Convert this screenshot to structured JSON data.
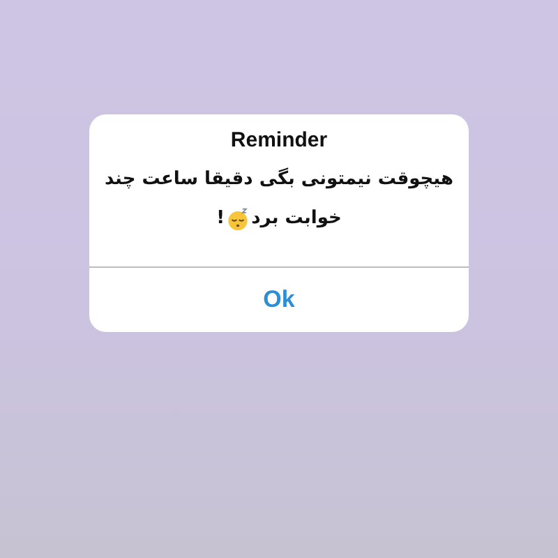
{
  "alert": {
    "title": "Reminder",
    "message_lines": [
      "هیچوقت نیمتونی بگی دقیقا ساعت چند",
      "خوابت برد"
    ],
    "message_end": "!",
    "buttons": [
      {
        "label": "Ok",
        "kind": "default"
      }
    ]
  }
}
